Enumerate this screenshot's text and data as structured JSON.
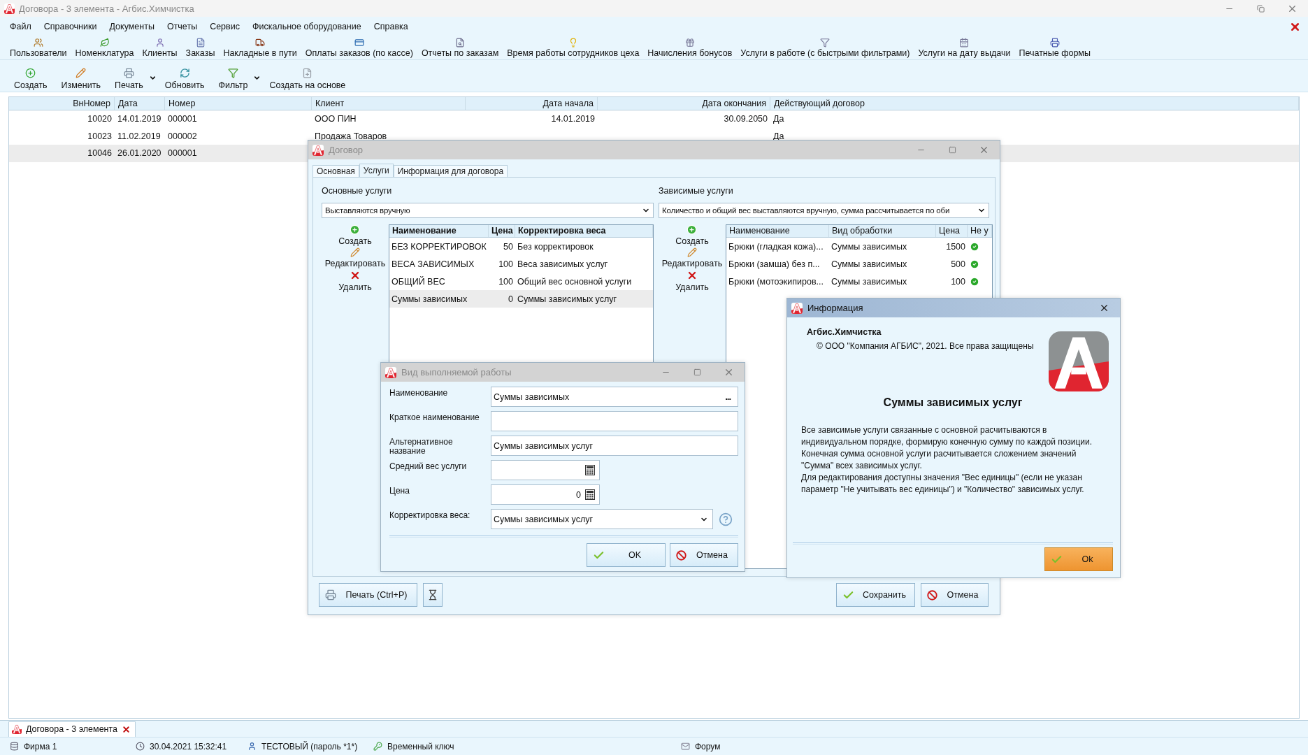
{
  "window": {
    "title": "Договора - 3 элемента - Агбис.Химчистка"
  },
  "menu": [
    "Файл",
    "Справочники",
    "Документы",
    "Отчеты",
    "Сервис",
    "Фискальное оборудование",
    "Справка"
  ],
  "toolbar": [
    "Пользователи",
    "Номенклатура",
    "Клиенты",
    "Заказы",
    "Накладные в пути",
    "Оплаты заказов (по кассе)",
    "Отчеты по заказам",
    "Время работы сотрудников цеха",
    "Начисления бонусов",
    "Услуги в работе (с быстрыми фильтрами)",
    "Услуги на дату выдачи",
    "Печатные формы"
  ],
  "actions": [
    {
      "label": "Создать",
      "dropdown": false
    },
    {
      "label": "Изменить",
      "dropdown": false
    },
    {
      "label": "Печать",
      "dropdown": true
    },
    {
      "label": "Обновить",
      "dropdown": false
    },
    {
      "label": "Фильтр",
      "dropdown": true
    },
    {
      "label": "Создать на основе",
      "dropdown": false
    }
  ],
  "table": {
    "columns": [
      "ВнНомер",
      "Дата",
      "Номер",
      "Клиент",
      "Дата начала",
      "Дата окончания",
      "Действующий договор"
    ],
    "rows": [
      {
        "in_number": "10020",
        "date": "14.01.2019",
        "number": "000001",
        "client": "ООО ПИН",
        "start_date": "14.01.2019",
        "end_date": "30.09.2050",
        "active": "Да",
        "selected": false
      },
      {
        "in_number": "10023",
        "date": "11.02.2019",
        "number": "000002",
        "client": "Продажа Товаров",
        "active": "Да",
        "selected": false
      },
      {
        "in_number": "10046",
        "date": "26.01.2020",
        "number": "000001",
        "selected": true
      }
    ]
  },
  "contract_dialog": {
    "title": "Договор",
    "tabs": [
      {
        "label": "Основная",
        "selected": false
      },
      {
        "label": "Услуги",
        "selected": true
      },
      {
        "label": "Информация для договора",
        "selected": false
      }
    ],
    "main_services": {
      "label": "Основные услуги",
      "mode": "Выставляются вручную",
      "buttons": [
        {
          "kind": "create",
          "label": "Создать"
        },
        {
          "kind": "edit",
          "label": "Редактировать"
        },
        {
          "kind": "delete",
          "label": "Удалить"
        }
      ],
      "columns": [
        "Наименование",
        "Цена",
        "Корректировка веса"
      ],
      "rows": [
        {
          "name": "БЕЗ КОРРЕКТИРОВОК",
          "price": "50",
          "correction": "Без корректировок",
          "selected": false
        },
        {
          "name": "ВЕСА ЗАВИСИМЫХ",
          "price": "100",
          "correction": "Веса зависимых услуг",
          "selected": false
        },
        {
          "name": "ОБЩИЙ ВЕС",
          "price": "100",
          "correction": "Общий вес основной услуги",
          "selected": false
        },
        {
          "name": "Суммы зависимых",
          "price": "0",
          "correction": "Суммы зависимых услуг",
          "selected": true
        }
      ]
    },
    "dependent_services": {
      "label": "Зависимые услуги",
      "mode": "Количество и общий вес выставляются вручную, сумма рассчитывается по оби",
      "buttons": [
        {
          "kind": "create",
          "label": "Создать"
        },
        {
          "kind": "edit",
          "label": "Редактировать"
        },
        {
          "kind": "delete",
          "label": "Удалить"
        }
      ],
      "columns": [
        "Наименование",
        "Вид обработки",
        "Цена",
        "Не у"
      ],
      "rows": [
        {
          "name": "Брюки (гладкая кожа)...",
          "processing": "Суммы зависимых",
          "price": "1500",
          "checked": true
        },
        {
          "name": "Брюки (замша) без п...",
          "processing": "Суммы зависимых",
          "price": "500",
          "checked": true
        },
        {
          "name": "Брюки (мотоэкипиров...",
          "processing": "Суммы зависимых",
          "price": "100",
          "checked": true
        }
      ]
    },
    "print_button": "Печать (Ctrl+P)",
    "save_button": "Сохранить",
    "cancel_button": "Отмена"
  },
  "work_dialog": {
    "title": "Вид выполняемой работы",
    "fields": [
      {
        "kind": "lookup",
        "label": "Наименование",
        "value": "Суммы зависимых",
        "button": "..."
      },
      {
        "kind": "text",
        "label": "Краткое наименование"
      },
      {
        "kind": "text",
        "label": "Альтернативное название",
        "value": "Суммы зависимых услуг"
      },
      {
        "kind": "number",
        "label": "Средний вес услуги"
      },
      {
        "kind": "number",
        "label": "Цена",
        "value": "0"
      },
      {
        "kind": "select",
        "label": "Корректировка веса:",
        "value": "Суммы зависимых услуг"
      }
    ],
    "ok_button": "OK",
    "cancel_button": "Отмена"
  },
  "info_dialog": {
    "title": "Информация",
    "product": "Агбис.Химчистка",
    "copyright": "© ООО \"Компания АГБИС\", 2021. Все права защищены",
    "heading": "Суммы зависимых услуг",
    "paragraphs": [
      "Все зависимые услуги связанные с основной расчитываются в индивидуальном порядке, формирую конечную сумму по каждой позиции.",
      "Конечная сумма основной услуги расчитывается сложением значений \"Сумма\" всех зависимых услуг.",
      "Для редактирования доступны значения \"Вес единицы\" (если не указан параметр \"Не учитывать вес единицы\") и \"Количество\" зависимых услуг."
    ],
    "ok_button": "Ok"
  },
  "document_tab": {
    "label": "Договора - 3 элемента"
  },
  "status_bar": [
    "Фирма 1",
    "30.04.2021 15:32:41",
    "ТЕСТОВЫЙ (пароль *1*)",
    "Временный ключ",
    "Форум"
  ]
}
